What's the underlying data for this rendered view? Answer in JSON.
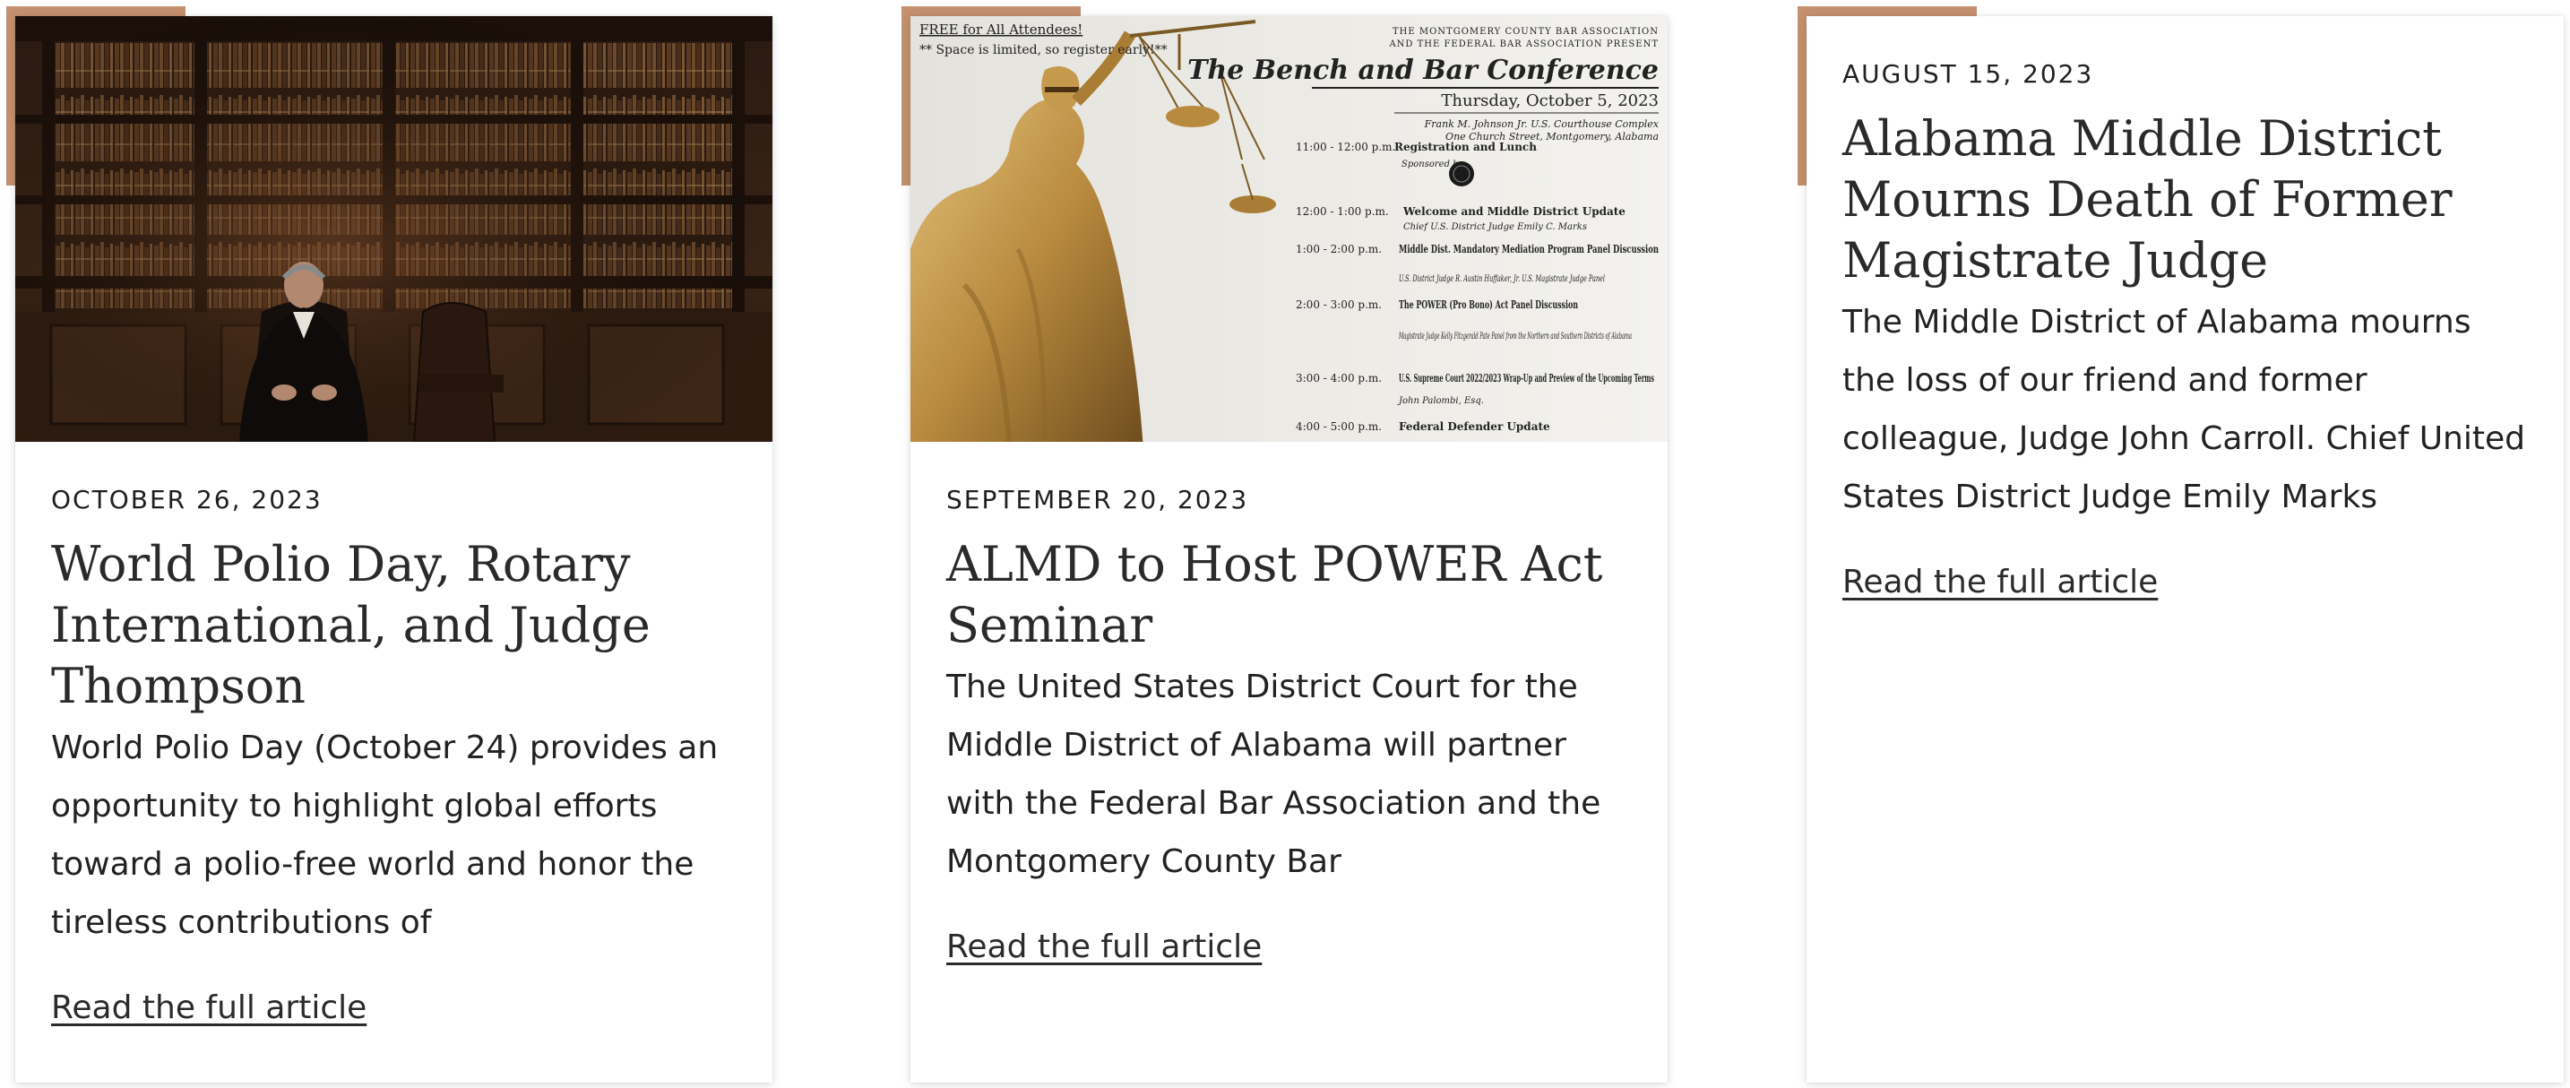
{
  "articles": [
    {
      "date": "OCTOBER 26, 2023",
      "title": "World Polio Day, Rotary International, and Judge Thompson",
      "excerpt": "World Polio Day (October 24) provides an opportunity to highlight global efforts toward a polio-free world and honor the tireless contributions of",
      "link_label": "Read the full article",
      "image": "judge-in-library-photo"
    },
    {
      "date": "SEPTEMBER 20, 2023",
      "title": "ALMD to Host POWER Act Seminar",
      "excerpt": "The United States District Court for the Middle District of Alabama will partner with the Federal Bar Association and the Montgomery County Bar",
      "link_label": "Read the full article",
      "image": "bench-and-bar-conference-flyer",
      "flyer": {
        "free_line": "FREE for All Attendees!",
        "space_line": "** Space is limited, so register early!**",
        "presenters_line1": "THE MONTGOMERY COUNTY BAR ASSOCIATION",
        "presenters_line2": "AND THE FEDERAL BAR ASSOCIATION PRESENT",
        "title": "The Bench and Bar Conference",
        "date": "Thursday, October 5, 2023",
        "venue_line1": "Frank M. Johnson Jr. U.S. Courthouse Complex",
        "venue_line2": "One Church Street, Montgomery, Alabama",
        "schedule": [
          {
            "time": "11:00 - 12:00 p.m.",
            "event": "Registration and Lunch",
            "detail": "Sponsored by"
          },
          {
            "time": "12:00 - 1:00 p.m.",
            "event": "Welcome and Middle District Update",
            "detail": "Chief U.S. District Judge Emily C. Marks"
          },
          {
            "time": "1:00 - 2:00 p.m.",
            "event": "Middle Dist. Mandatory Mediation Program Panel Discussion",
            "detail": "U.S. District Judge R. Austin Huffaker, Jr. U.S. Magistrate Judge Panel"
          },
          {
            "time": "2:00 - 3:00 p.m.",
            "event": "The POWER (Pro Bono) Act Panel Discussion",
            "detail": "Magistrate Judge Kelly Fitzgerald Pate Panel from the Northern and Southern Districts of Alabama"
          },
          {
            "time": "3:00 - 4:00 p.m.",
            "event": "U.S. Supreme Court 2022/2023 Wrap-Up and Preview of the Upcoming Terms",
            "detail": "John Palombi, Esq."
          },
          {
            "time": "4:00 - 5:00 p.m.",
            "event": "Federal Defender Update",
            "detail": ""
          }
        ]
      }
    },
    {
      "date": "AUGUST 15, 2023",
      "title": "Alabama Middle District Mourns Death of Former Magistrate Judge",
      "excerpt": "The Middle District of Alabama mourns the loss of our friend and former colleague, Judge John Carroll. Chief United States District Judge Emily Marks",
      "link_label": "Read the full article"
    }
  ],
  "colors": {
    "accent": "#c4916f",
    "text": "#222222",
    "card_background": "#ffffff"
  }
}
